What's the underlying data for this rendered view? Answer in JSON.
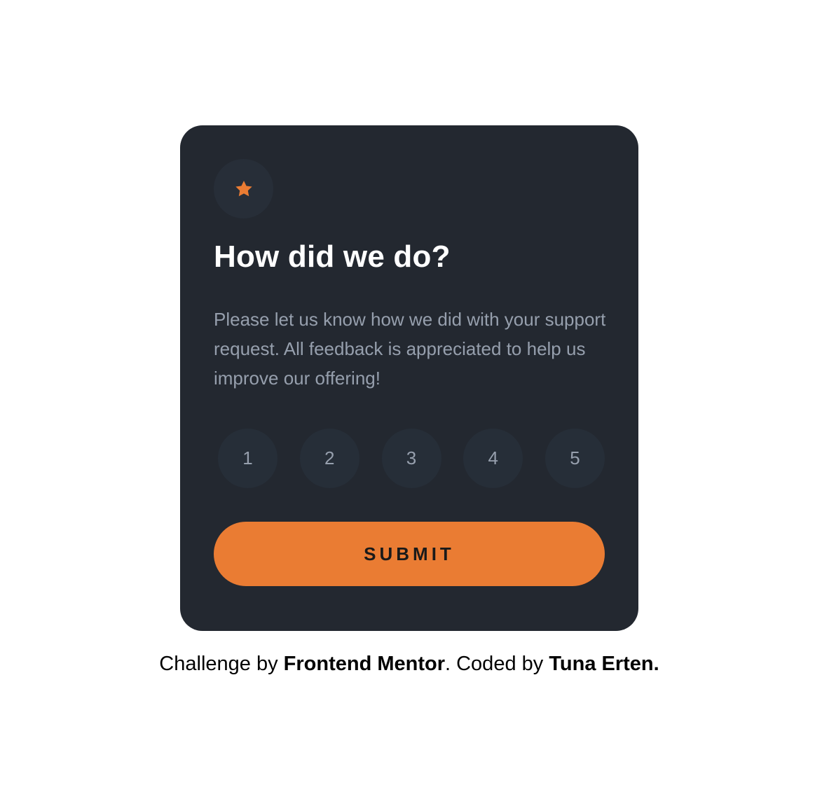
{
  "card": {
    "icon": "star-icon",
    "title": "How did we do?",
    "description": "Please let us know how we did with your support request. All feedback is appreciated to help us improve our offering!",
    "ratings": [
      "1",
      "2",
      "3",
      "4",
      "5"
    ],
    "submit_label": "SUBMIT"
  },
  "attribution": {
    "prefix": "Challenge by ",
    "link1": "Frontend Mentor",
    "middle": ". Coded by ",
    "link2": "Tuna Erten",
    "suffix": "."
  },
  "colors": {
    "card_bg": "#232830",
    "accent": "#ea7c33",
    "rating_bg": "#262e38",
    "muted_text": "#969fad",
    "title_text": "#ffffff"
  }
}
